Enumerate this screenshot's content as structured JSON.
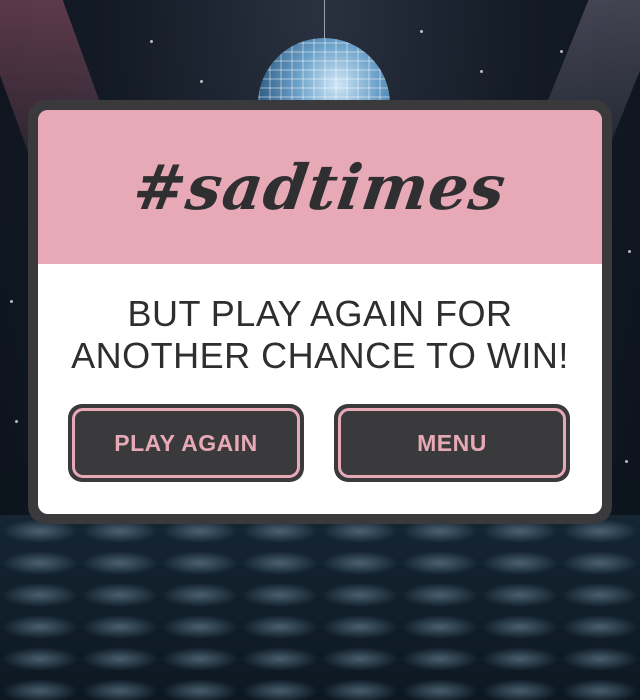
{
  "popup": {
    "title": "#sadtimes",
    "message_line1": "BUT PLAY AGAIN FOR",
    "message_line2": "ANOTHER CHANCE TO WIN!"
  },
  "buttons": {
    "play_again": "PLAY AGAIN",
    "menu": "MENU"
  },
  "colors": {
    "accent_pink": "#e7a9b6",
    "frame_dark": "#3a3a3c",
    "text_dark": "#2e2e30",
    "panel_white": "#ffffff"
  },
  "icons": [
    "disco-ball-icon"
  ]
}
